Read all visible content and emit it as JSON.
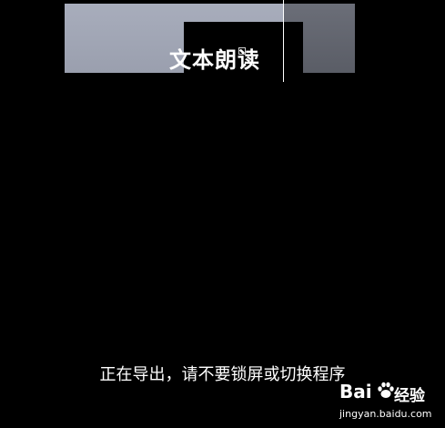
{
  "video": {
    "title_text": "文本朗读"
  },
  "export": {
    "status_text": "正在导出，请不要锁屏或切换程序"
  },
  "watermark": {
    "brand": "Bai",
    "icon": "paw-icon",
    "text": "经验",
    "url": "jingyan.baidu.com"
  }
}
